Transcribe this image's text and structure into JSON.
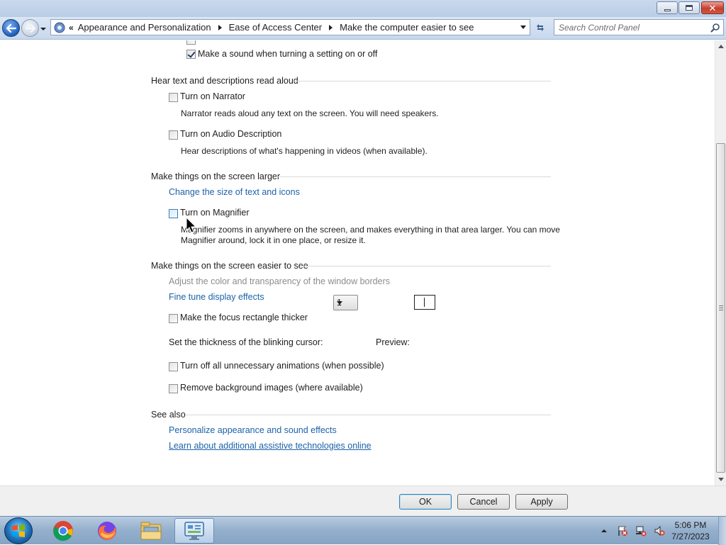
{
  "window": {
    "minimize_icon": "minimize-icon",
    "maximize_icon": "maximize-icon",
    "close_icon": "close-icon"
  },
  "nav": {
    "address_chevron": "«",
    "breadcrumbs": [
      {
        "label": "Appearance and Personalization"
      },
      {
        "label": "Ease of Access Center"
      },
      {
        "label": "Make the computer easier to see"
      }
    ],
    "search_placeholder": "Search Control Panel"
  },
  "content": {
    "top_option": {
      "label": "Make a sound when turning a setting on or off",
      "checked": true
    },
    "sections": {
      "narrator": {
        "title": "Hear text and descriptions read aloud",
        "narrator_label": "Turn on Narrator",
        "narrator_desc": "Narrator reads aloud any text on the screen. You will need speakers.",
        "audio_desc_label": "Turn on Audio Description",
        "audio_desc_desc": "Hear descriptions of what's happening in videos (when available)."
      },
      "larger": {
        "title": "Make things on the screen larger",
        "text_size_link": "Change the size of text and icons",
        "magnifier_label": "Turn on Magnifier",
        "magnifier_desc_1": "Magnifier zooms in anywhere on the screen, and makes everything in that area larger. You can move",
        "magnifier_desc_2": "Magnifier around, lock it in one place, or resize it."
      },
      "easier": {
        "title": "Make things on the screen easier to see",
        "color_link_disabled": "Adjust the color and transparency of the window borders",
        "fine_tune_link": "Fine tune display effects",
        "focus_label": "Make the focus rectangle thicker",
        "cursor_label": "Set the thickness of the blinking cursor:",
        "cursor_value": "1",
        "preview_label": "Preview:",
        "animations_label": "Turn off all unnecessary animations (when possible)",
        "bg_images_label": "Remove background images (where available)"
      },
      "see_also": {
        "title": "See also",
        "personalize_link": "Personalize appearance and sound effects",
        "assistive_link": "Learn about additional assistive technologies online"
      }
    }
  },
  "footer": {
    "ok": "OK",
    "cancel": "Cancel",
    "apply": "Apply"
  },
  "taskbar": {
    "items": [
      "start-orb",
      "chrome-icon",
      "firefox-icon",
      "explorer-icon",
      "control-panel-icon"
    ],
    "time": "5:06 PM",
    "date": "7/27/2023"
  },
  "colors": {
    "link": "#1b63a8",
    "disabled_text": "#8c8c8c",
    "titlebar": "#c9d9ee",
    "taskbar": "#93afcc"
  }
}
